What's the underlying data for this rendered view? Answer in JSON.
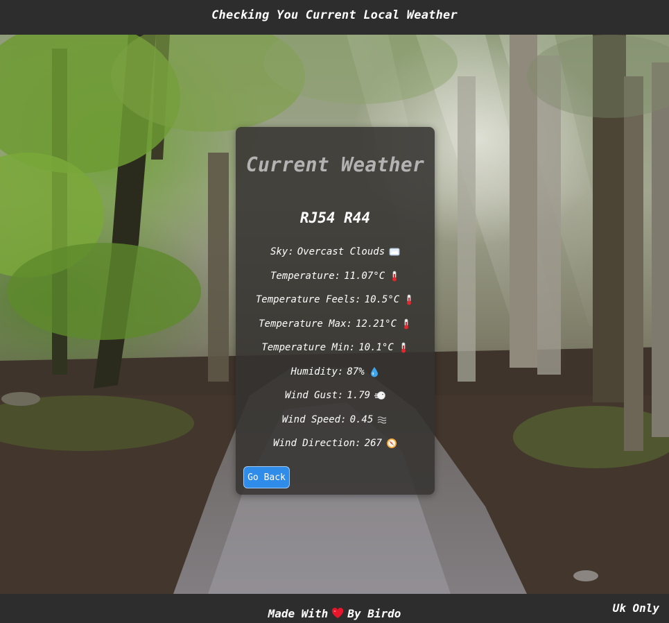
{
  "header": {
    "title": "Checking You Current Local Weather"
  },
  "weather_card": {
    "title": "Current Weather",
    "postcode": "RJ54 R44",
    "rows": [
      {
        "label": "Sky:",
        "value": "Overcast Clouds",
        "icon": "cloud-icon"
      },
      {
        "label": "Temperature:",
        "value": "11.07°C",
        "icon": "thermometer-icon"
      },
      {
        "label": "Temperature Feels:",
        "value": "10.5°C",
        "icon": "thermometer-icon"
      },
      {
        "label": "Temperature Max:",
        "value": "12.21°C",
        "icon": "thermometer-icon"
      },
      {
        "label": "Temperature Min:",
        "value": "10.1°C",
        "icon": "thermometer-icon"
      },
      {
        "label": "Humidity:",
        "value": "87%",
        "icon": "droplet-icon"
      },
      {
        "label": "Wind Gust:",
        "value": "1.79",
        "icon": "wind-face-icon"
      },
      {
        "label": "Wind Speed:",
        "value": "0.45",
        "icon": "waves-icon"
      },
      {
        "label": "Wind Direction:",
        "value": "267",
        "icon": "compass-icon"
      }
    ],
    "back_button_label": "Go Back"
  },
  "footer": {
    "credit_prefix": "Made With",
    "credit_suffix": "By Birdo",
    "heart_icon": "heart-icon",
    "region": "Uk Only"
  },
  "colors": {
    "bar_background": "#2d2d2d",
    "card_background": "#343230",
    "button_blue": "#2f8ce8",
    "title_grey": "#b3b3b3",
    "heart_red": "#e8162b"
  }
}
